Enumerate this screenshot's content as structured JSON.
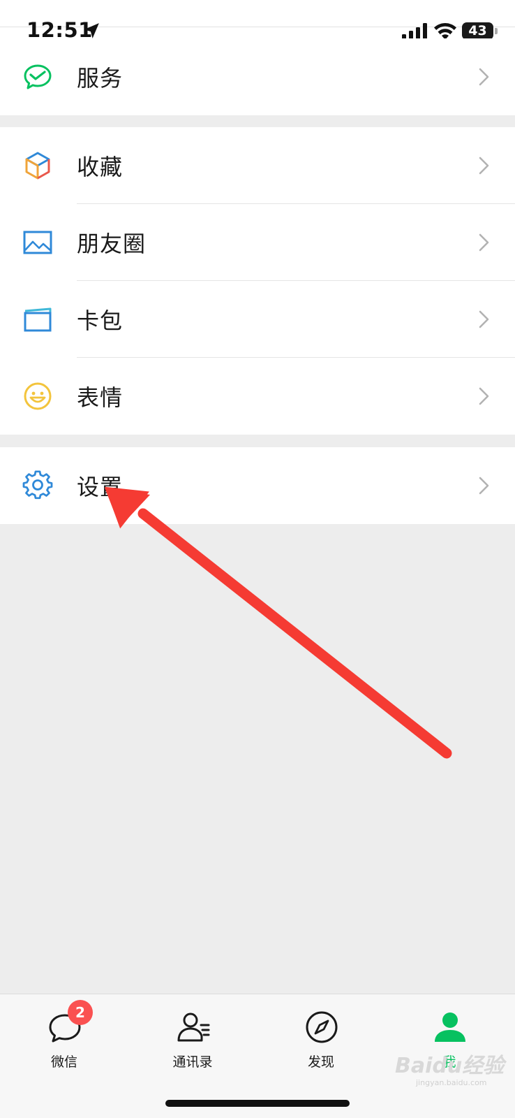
{
  "status_bar": {
    "time": "12:51",
    "battery": "43",
    "icons": [
      "location-arrow-icon",
      "cellular-signal-icon",
      "wifi-icon",
      "battery-icon"
    ]
  },
  "menu": {
    "groups": [
      {
        "items": [
          {
            "label": "服务",
            "icon": "wechat-pay-service-icon",
            "color": "#07c160"
          }
        ]
      },
      {
        "items": [
          {
            "label": "收藏",
            "icon": "favorites-cube-icon",
            "color": "#f0a43a"
          },
          {
            "label": "朋友圈",
            "icon": "moments-picture-icon",
            "color": "#2f89d8"
          },
          {
            "label": "卡包",
            "icon": "card-wallet-icon",
            "color": "#2f89d8"
          },
          {
            "label": "表情",
            "icon": "sticker-smiley-icon",
            "color": "#f3c43c"
          }
        ]
      },
      {
        "items": [
          {
            "label": "设置",
            "icon": "settings-gear-icon",
            "color": "#2f89d8"
          }
        ]
      }
    ]
  },
  "tabbar": {
    "tabs": [
      {
        "label": "微信",
        "icon": "chat-bubble-icon",
        "badge": "2",
        "active": false
      },
      {
        "label": "通讯录",
        "icon": "contacts-icon",
        "active": false
      },
      {
        "label": "发现",
        "icon": "discover-compass-icon",
        "active": false
      },
      {
        "label": "我",
        "icon": "me-person-icon",
        "active": true
      }
    ]
  },
  "colors": {
    "accent": "#07c160",
    "background": "#ededed",
    "annotation_arrow": "#f53b33",
    "badge": "#fa5151"
  },
  "watermark": {
    "text": "Baidu经验",
    "sub": "jingyan.baidu.com"
  }
}
